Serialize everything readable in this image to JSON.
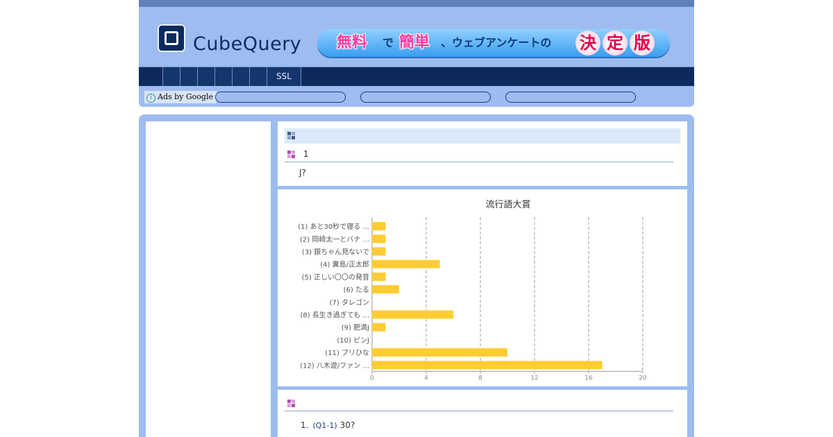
{
  "brand": {
    "logo_text": "CubeQuery"
  },
  "banner": {
    "part1": "無料",
    "part2": "で",
    "part3": "簡単",
    "part4": "、ウェブアンケートの",
    "badge_chars": [
      "決",
      "定",
      "版"
    ]
  },
  "nav": {
    "ssl_label": "SSL"
  },
  "ads": {
    "label": "Ads by Google",
    "info_icon": "info-icon"
  },
  "question": {
    "number": "1",
    "text": "J?"
  },
  "chart_data": {
    "type": "bar",
    "orientation": "horizontal",
    "title": "流行語大賞",
    "categories": [
      "(1) あと30秒で寝る ...",
      "(2) 岡崎太一とバナ ...",
      "(3) 銀ちゃん見ないで",
      "(4) 糞島/正太郎",
      "(5) 正しい〇〇の発音",
      "(6) たる",
      "(7) タレゴン",
      "(8) 長生き過ぎても ...",
      "(9) 肥満J",
      "(10) ピンJ",
      "(11) ブリひな",
      "(12) 八木遊/ファン ..."
    ],
    "values": [
      1,
      1,
      1,
      5,
      1,
      2,
      0,
      6,
      1,
      0,
      10,
      17
    ],
    "xlim": [
      0,
      20
    ],
    "xticks": [
      "0",
      "4",
      "8",
      "12",
      "16",
      "20"
    ],
    "grid": "vertical dashed",
    "bar_color": "#ffcc33"
  },
  "answers": [
    {
      "index": "1.",
      "code": "(Q1-1)",
      "text": "30?"
    }
  ]
}
